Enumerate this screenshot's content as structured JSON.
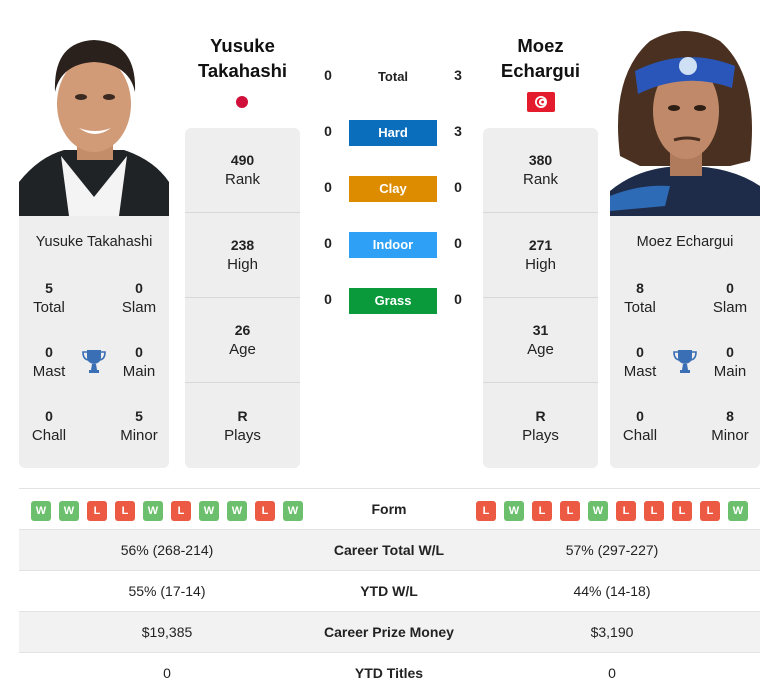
{
  "player1": {
    "name_line1": "Yusuke",
    "name_line2": "Takahashi",
    "full_name": "Yusuke Takahashi",
    "flag": "japan-flag",
    "stats": [
      {
        "value": "490",
        "label": "Rank"
      },
      {
        "value": "238",
        "label": "High"
      },
      {
        "value": "26",
        "label": "Age"
      },
      {
        "value": "R",
        "label": "Plays"
      }
    ],
    "titles": {
      "total": {
        "value": "5",
        "label": "Total"
      },
      "slam": {
        "value": "0",
        "label": "Slam"
      },
      "mast": {
        "value": "0",
        "label": "Mast"
      },
      "main": {
        "value": "0",
        "label": "Main"
      },
      "chall": {
        "value": "0",
        "label": "Chall"
      },
      "minor": {
        "value": "5",
        "label": "Minor"
      }
    },
    "form": [
      "W",
      "W",
      "L",
      "L",
      "W",
      "L",
      "W",
      "W",
      "L",
      "W"
    ]
  },
  "player2": {
    "name_line1": "Moez",
    "name_line2": "Echargui",
    "full_name": "Moez Echargui",
    "flag": "tunisia-flag",
    "stats": [
      {
        "value": "380",
        "label": "Rank"
      },
      {
        "value": "271",
        "label": "High"
      },
      {
        "value": "31",
        "label": "Age"
      },
      {
        "value": "R",
        "label": "Plays"
      }
    ],
    "titles": {
      "total": {
        "value": "8",
        "label": "Total"
      },
      "slam": {
        "value": "0",
        "label": "Slam"
      },
      "mast": {
        "value": "0",
        "label": "Mast"
      },
      "main": {
        "value": "0",
        "label": "Main"
      },
      "chall": {
        "value": "0",
        "label": "Chall"
      },
      "minor": {
        "value": "8",
        "label": "Minor"
      }
    },
    "form": [
      "L",
      "W",
      "L",
      "L",
      "W",
      "L",
      "L",
      "L",
      "L",
      "W"
    ]
  },
  "h2h": [
    {
      "label": "Total",
      "p1": "0",
      "p2": "3",
      "color": ""
    },
    {
      "label": "Hard",
      "p1": "0",
      "p2": "3",
      "color": "#0a6ebd"
    },
    {
      "label": "Clay",
      "p1": "0",
      "p2": "0",
      "color": "#dd8c00"
    },
    {
      "label": "Indoor",
      "p1": "0",
      "p2": "0",
      "color": "#2ea0f5"
    },
    {
      "label": "Grass",
      "p1": "0",
      "p2": "0",
      "color": "#0a9a3c"
    }
  ],
  "form_label": "Form",
  "comparison": [
    {
      "label": "Career Total W/L",
      "p1": "56% (268-214)",
      "p2": "57% (297-227)"
    },
    {
      "label": "YTD W/L",
      "p1": "55% (17-14)",
      "p2": "44% (14-18)"
    },
    {
      "label": "Career Prize Money",
      "p1": "$19,385",
      "p2": "$3,190"
    },
    {
      "label": "YTD Titles",
      "p1": "0",
      "p2": "0"
    }
  ],
  "colors": {
    "win": "#6cbf6c",
    "loss": "#ec5a43",
    "trophy": "#3a6fb5",
    "card_bg": "#eeeeee"
  }
}
